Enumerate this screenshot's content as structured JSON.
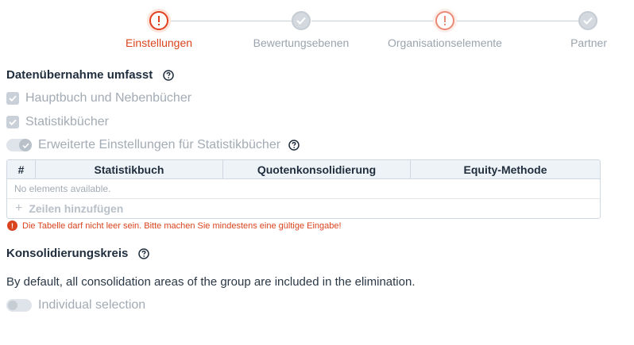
{
  "stepper": {
    "steps": [
      {
        "label": "Einstellungen",
        "state": "error",
        "active": true
      },
      {
        "label": "Bewertungsebenen",
        "state": "complete",
        "active": false
      },
      {
        "label": "Organisationselemente",
        "state": "error",
        "active": false
      },
      {
        "label": "Partner",
        "state": "complete",
        "active": false
      }
    ]
  },
  "data_transfer": {
    "title": "Datenübernahme umfasst",
    "options": [
      {
        "label": "Hauptbuch und Nebenbücher",
        "checked": true,
        "disabled": true
      },
      {
        "label": "Statistikbücher",
        "checked": true,
        "disabled": true
      }
    ],
    "advanced_toggle": {
      "label": "Erweiterte Einstellungen für Statistikbücher",
      "on": true,
      "disabled": true
    }
  },
  "table": {
    "columns": [
      "#",
      "Statistikbuch",
      "Quotenkonsolidierung",
      "Equity-Methode"
    ],
    "empty_text": "No elements available.",
    "add_row_label": "Zeilen hinzufügen",
    "add_icon": "+"
  },
  "error": {
    "icon": "!",
    "message": "Die Tabelle darf nicht leer sein. Bitte machen Sie mindestens eine gültige Eingabe!"
  },
  "consolidation": {
    "title": "Konsolidierungskreis",
    "description": "By default, all consolidation areas of the group are included in the elimination.",
    "individual_toggle": {
      "label": "Individual selection",
      "on": false,
      "disabled": true
    }
  },
  "colors": {
    "error": "#d9441f",
    "muted": "#a3abb4",
    "header_bg": "#eef3f7"
  }
}
